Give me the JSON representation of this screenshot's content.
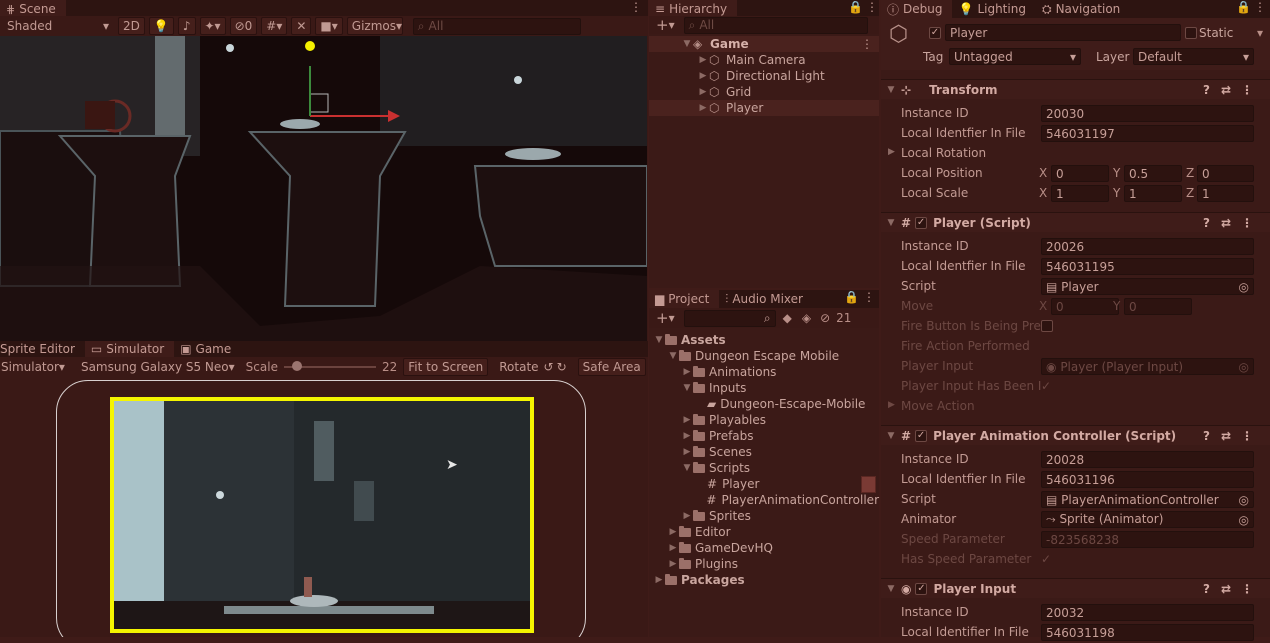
{
  "scene": {
    "tab": "Scene",
    "shading": "Shaded",
    "mode_2d": "2D",
    "hidden_count": "0",
    "gizmos": "Gizmos",
    "search_placeholder": "All"
  },
  "hierarchy": {
    "tab": "Hierarchy",
    "search_placeholder": "All",
    "root": "Game",
    "items": [
      "Main Camera",
      "Directional Light",
      "Grid",
      "Player"
    ]
  },
  "inspector": {
    "tabs": [
      "Debug",
      "Lighting",
      "Navigation"
    ],
    "object_name": "Player",
    "static_label": "Static",
    "tag_label": "Tag",
    "tag_value": "Untagged",
    "layer_label": "Layer",
    "layer_value": "Default",
    "transform": {
      "title": "Transform",
      "instance_id_label": "Instance ID",
      "instance_id": "20030",
      "local_id_label": "Local Identfier In File",
      "local_id": "546031197",
      "rotation_label": "Local Rotation",
      "position_label": "Local Position",
      "pos_x": "0",
      "pos_y": "0.5",
      "pos_z": "0",
      "scale_label": "Local Scale",
      "scale_x": "1",
      "scale_y": "1",
      "scale_z": "1"
    },
    "player_script": {
      "title": "Player (Script)",
      "instance_id_label": "Instance ID",
      "instance_id": "20026",
      "local_id_label": "Local Identfier In File",
      "local_id": "546031195",
      "script_label": "Script",
      "script_value": "Player",
      "move_label": "Move",
      "move_x": "0",
      "move_y": "0",
      "fire_pressed_label": "Fire Button Is Being Pres",
      "fire_performed_label": "Fire Action Performed",
      "player_input_label": "Player Input",
      "player_input_value": "Player (Player Input)",
      "has_been_label": "Player Input Has Been In",
      "move_action_label": "Move Action"
    },
    "anim_script": {
      "title": "Player Animation Controller (Script)",
      "instance_id_label": "Instance ID",
      "instance_id": "20028",
      "local_id_label": "Local Identfier In File",
      "local_id": "546031196",
      "script_label": "Script",
      "script_value": "PlayerAnimationController",
      "animator_label": "Animator",
      "animator_value": "Sprite (Animator)",
      "speed_param_label": "Speed Parameter",
      "speed_param_value": "-823568238",
      "has_speed_label": "Has Speed Parameter"
    },
    "player_input": {
      "title": "Player Input",
      "instance_id_label": "Instance ID",
      "instance_id": "20032",
      "local_id_label": "Local Identifier In File",
      "local_id": "546031198"
    },
    "axis_x": "X",
    "axis_y": "Y",
    "axis_z": "Z"
  },
  "bottom_tabs": [
    "Sprite Editor",
    "Simulator",
    "Game"
  ],
  "simulator": {
    "mode": "Simulator",
    "device": "Samsung Galaxy S5 Neo",
    "scale_label": "Scale",
    "scale_value": "22",
    "fit": "Fit to Screen",
    "rotate": "Rotate",
    "safe_area": "Safe Area"
  },
  "project": {
    "tabs": [
      "Project",
      "Audio Mixer"
    ],
    "hidden_count": "21",
    "tree": [
      {
        "label": "Assets",
        "depth": 0,
        "type": "folder",
        "open": true,
        "bold": true
      },
      {
        "label": "Dungeon Escape Mobile",
        "depth": 1,
        "type": "folder",
        "open": true
      },
      {
        "label": "Animations",
        "depth": 2,
        "type": "folder",
        "open": false
      },
      {
        "label": "Inputs",
        "depth": 2,
        "type": "folder",
        "open": true
      },
      {
        "label": "Dungeon-Escape-Mobile",
        "depth": 3,
        "type": "asset",
        "open": false
      },
      {
        "label": "Playables",
        "depth": 2,
        "type": "folder",
        "open": false
      },
      {
        "label": "Prefabs",
        "depth": 2,
        "type": "folder",
        "open": false
      },
      {
        "label": "Scenes",
        "depth": 2,
        "type": "folder",
        "open": false
      },
      {
        "label": "Scripts",
        "depth": 2,
        "type": "folder",
        "open": true
      },
      {
        "label": "Player",
        "depth": 3,
        "type": "script",
        "open": false
      },
      {
        "label": "PlayerAnimationController",
        "depth": 3,
        "type": "script",
        "open": false
      },
      {
        "label": "Sprites",
        "depth": 2,
        "type": "folder",
        "open": false
      },
      {
        "label": "Editor",
        "depth": 1,
        "type": "folder",
        "open": false
      },
      {
        "label": "GameDevHQ",
        "depth": 1,
        "type": "folder",
        "open": false
      },
      {
        "label": "Plugins",
        "depth": 1,
        "type": "folder",
        "open": false
      },
      {
        "label": "Packages",
        "depth": 0,
        "type": "folder",
        "open": false,
        "bold": true
      }
    ]
  },
  "colors": {
    "highlight": "#f5f500",
    "panel": "#3b1a17",
    "tabbar": "#2d1411"
  }
}
